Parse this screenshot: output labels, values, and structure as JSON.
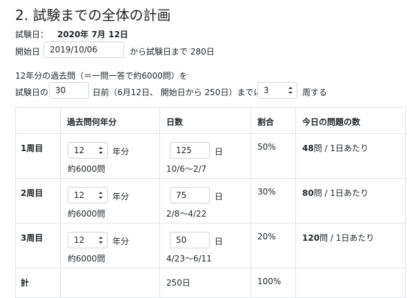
{
  "section_title": "2. 試験までの全体の計画",
  "exam": {
    "label": "試験日：",
    "date": "2020年 7月 12日"
  },
  "start": {
    "label": "開始日",
    "value": "2019/10/06",
    "suffix": "から試験日まで 280日"
  },
  "intro": "12年分の過去問（＝一問一答で約6000問）を",
  "plan": {
    "prefix": "試験日の",
    "days_before": "30",
    "middle": "日前（6月12日、 開始日から 250日）までに",
    "rounds_select": "3",
    "suffix": "周する"
  },
  "table": {
    "headers": [
      "過去問何年分",
      "日数",
      "割合",
      "今日の問題の数"
    ],
    "rows": [
      {
        "label": "1周目",
        "years": "12",
        "years_unit": "年分",
        "questions": "約6000問",
        "days": "125",
        "days_unit": "日",
        "range": "10/6〜2/7",
        "ratio": "50%",
        "today_count": "48",
        "today_suffix": "問 / 1日あたり"
      },
      {
        "label": "2周目",
        "years": "12",
        "years_unit": "年分",
        "questions": "約6000問",
        "days": "75",
        "days_unit": "日",
        "range": "2/8〜4/22",
        "ratio": "30%",
        "today_count": "80",
        "today_suffix": "問 / 1日あたり"
      },
      {
        "label": "3周目",
        "years": "12",
        "years_unit": "年分",
        "questions": "約6000問",
        "days": "50",
        "days_unit": "日",
        "range": "4/23〜6/11",
        "ratio": "20%",
        "today_count": "120",
        "today_suffix": "問 / 1日あたり"
      }
    ],
    "total": {
      "label": "計",
      "days": "250日",
      "ratio": "100%"
    }
  },
  "icons": {
    "select_caret": "updown-caret-icon"
  },
  "colors": {
    "border": "#dee2e6",
    "input_border": "#ced4da",
    "text": "#212529"
  }
}
